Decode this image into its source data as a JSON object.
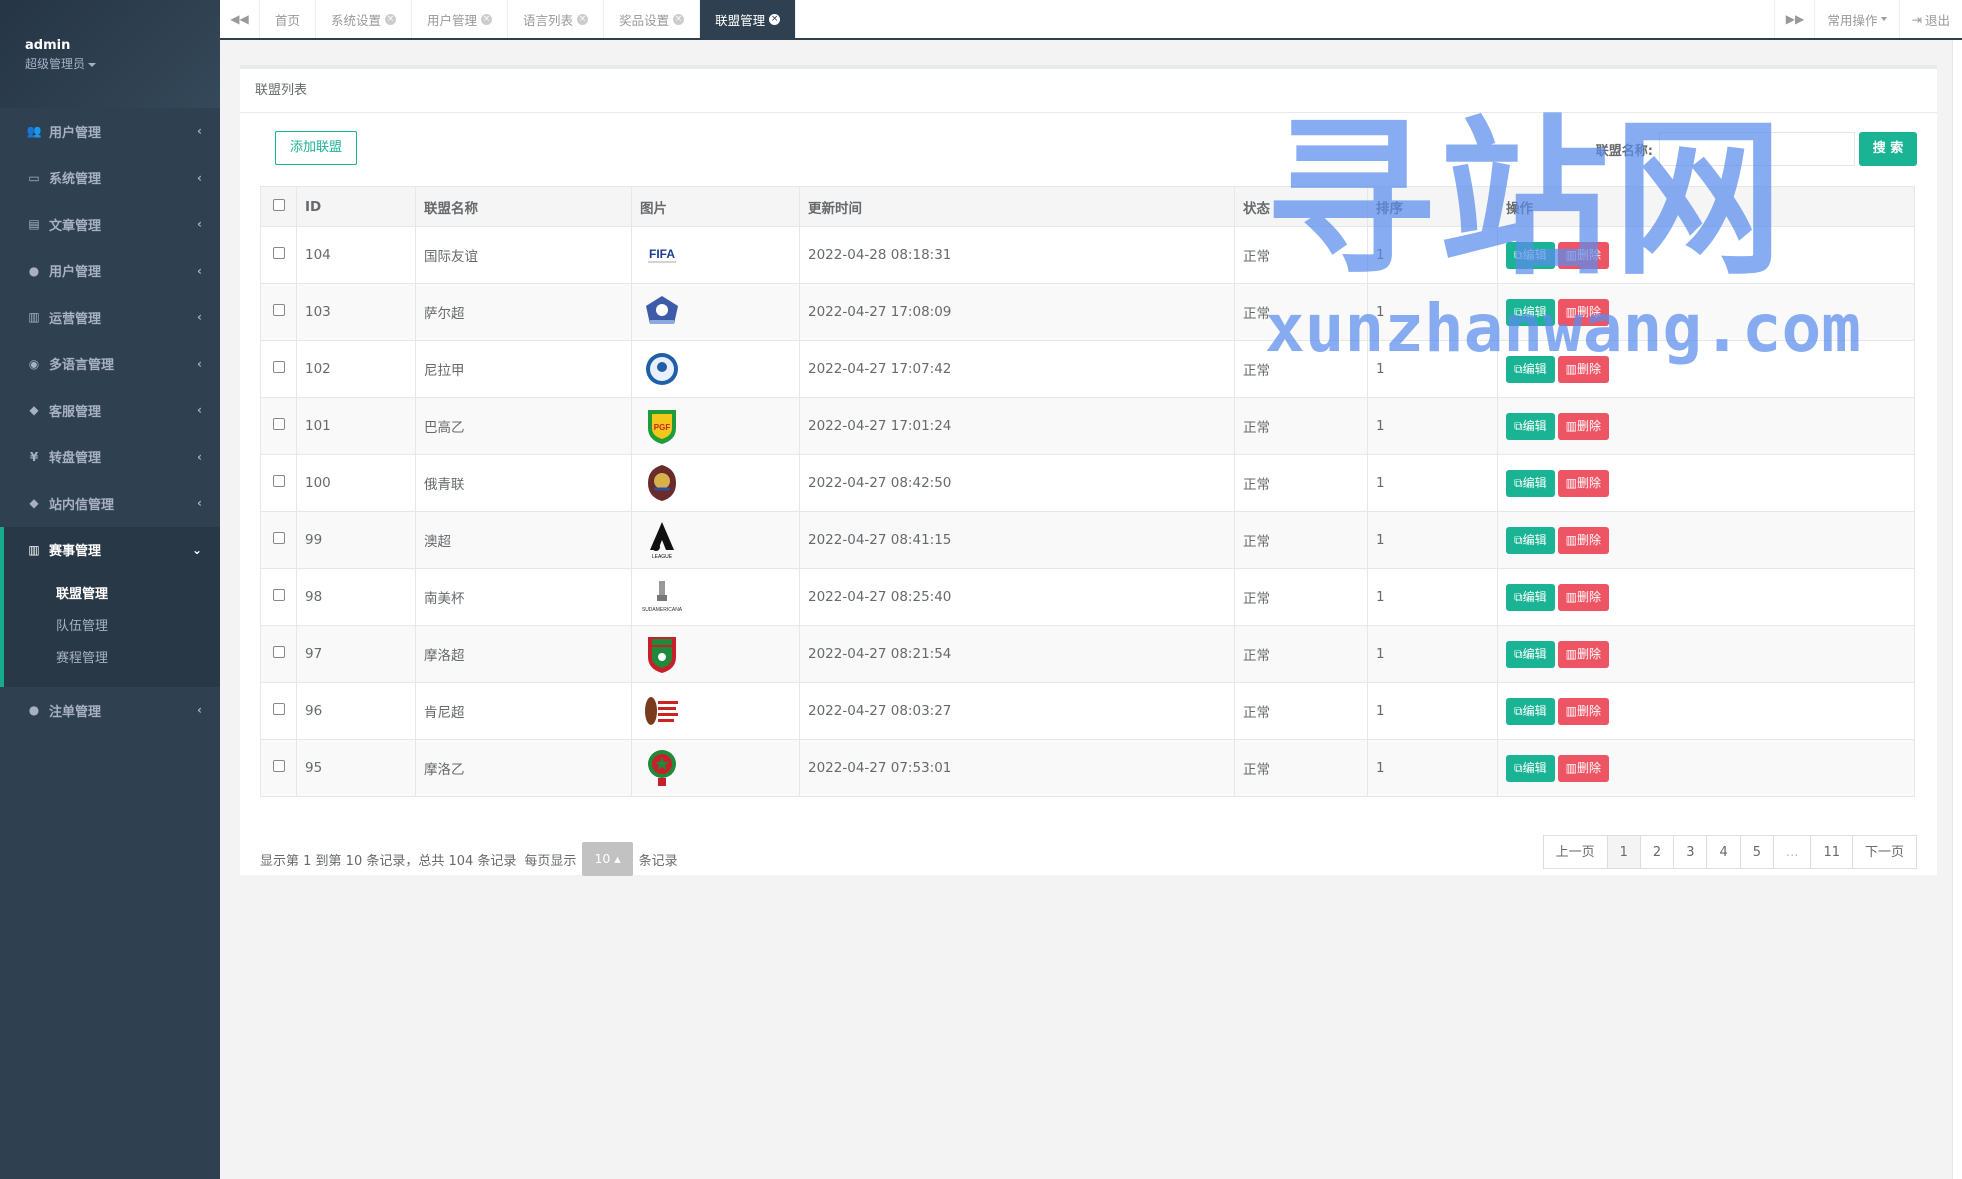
{
  "sidebar": {
    "user": {
      "name": "admin",
      "role": "超级管理员"
    },
    "items": [
      {
        "label": "用户管理",
        "icon": "users-icon"
      },
      {
        "label": "系统管理",
        "icon": "desktop-icon"
      },
      {
        "label": "文章管理",
        "icon": "book-icon"
      },
      {
        "label": "用户管理",
        "icon": "user-icon"
      },
      {
        "label": "运营管理",
        "icon": "bar-chart-icon"
      },
      {
        "label": "多语言管理",
        "icon": "globe-icon"
      },
      {
        "label": "客服管理",
        "icon": "comment-icon"
      },
      {
        "label": "转盘管理",
        "icon": "yen-icon"
      },
      {
        "label": "站内信管理",
        "icon": "comment-icon"
      }
    ],
    "active": {
      "label": "赛事管理",
      "icon": "bar-chart-icon"
    },
    "subitems": [
      "联盟管理",
      "队伍管理",
      "赛程管理"
    ],
    "last": {
      "label": "注单管理",
      "icon": "user-icon"
    }
  },
  "tabbar": {
    "tabs": [
      "首页",
      "系统设置",
      "用户管理",
      "语言列表",
      "奖品设置",
      "联盟管理"
    ],
    "common_ops": "常用操作",
    "logout": "退出"
  },
  "panel": {
    "title": "联盟列表",
    "add_button": "添加联盟",
    "search_label": "联盟名称:",
    "search_value": "",
    "search_button": "搜 索"
  },
  "table": {
    "headers": [
      "ID",
      "联盟名称",
      "图片",
      "更新时间",
      "状态",
      "排序",
      "操作"
    ],
    "edit_label": "编辑",
    "delete_label": "删除",
    "rows": [
      {
        "id": "104",
        "name": "国际友谊",
        "logo": "FIFA",
        "time": "2022-04-28 08:18:31",
        "status": "正常",
        "sort": "1"
      },
      {
        "id": "103",
        "name": "萨尔超",
        "logo": "badge-blue",
        "time": "2022-04-27 17:08:09",
        "status": "正常",
        "sort": "1"
      },
      {
        "id": "102",
        "name": "尼拉甲",
        "logo": "round-blue",
        "time": "2022-04-27 17:07:42",
        "status": "正常",
        "sort": "1"
      },
      {
        "id": "101",
        "name": "巴高乙",
        "logo": "shield-green",
        "time": "2022-04-27 17:01:24",
        "status": "正常",
        "sort": "1"
      },
      {
        "id": "100",
        "name": "俄青联",
        "logo": "shield-red",
        "time": "2022-04-27 08:42:50",
        "status": "正常",
        "sort": "1"
      },
      {
        "id": "99",
        "name": "澳超",
        "logo": "a-league",
        "time": "2022-04-27 08:41:15",
        "status": "正常",
        "sort": "1"
      },
      {
        "id": "98",
        "name": "南美杯",
        "logo": "trophy",
        "time": "2022-04-27 08:25:40",
        "status": "正常",
        "sort": "1"
      },
      {
        "id": "97",
        "name": "摩洛超",
        "logo": "shield-red-green",
        "time": "2022-04-27 08:21:54",
        "status": "正常",
        "sort": "1"
      },
      {
        "id": "96",
        "name": "肯尼超",
        "logo": "kenya",
        "time": "2022-04-27 08:03:27",
        "status": "正常",
        "sort": "1"
      },
      {
        "id": "95",
        "name": "摩洛乙",
        "logo": "round-star",
        "time": "2022-04-27 07:53:01",
        "status": "正常",
        "sort": "1"
      }
    ]
  },
  "pager": {
    "info_pre": "显示第 1 到第 10 条记录，总共 104 条记录",
    "per_page_label": "每页显示",
    "page_size": "10",
    "records_label": "条记录",
    "prev": "上一页",
    "next": "下一页",
    "pages": [
      "1",
      "2",
      "3",
      "4",
      "5",
      "...",
      "11"
    ],
    "current_page": 1
  },
  "watermark": {
    "big": "寻站网",
    "small": "xunzhanwang.com"
  },
  "colors": {
    "sidebar": "#2f4050",
    "primary": "#1ab394",
    "danger": "#ed5565",
    "watermark": "#5a8ceb"
  }
}
